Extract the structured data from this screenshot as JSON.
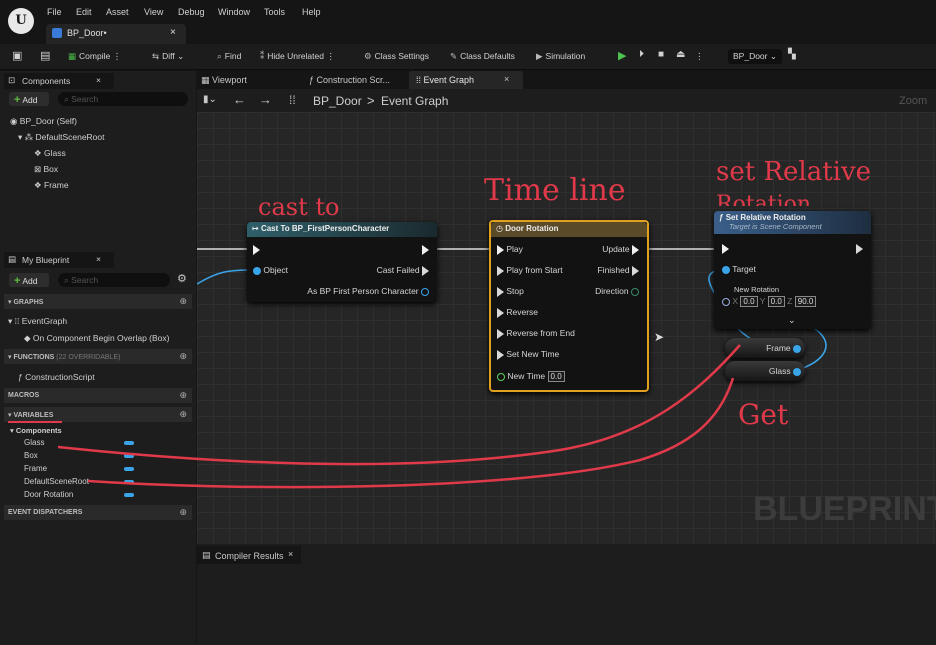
{
  "menu": [
    "File",
    "Edit",
    "Asset",
    "View",
    "Debug",
    "Window",
    "Tools",
    "Help"
  ],
  "doc_tab": {
    "label": "BP_Door•",
    "close": "×"
  },
  "toolbar": {
    "compile": "Compile",
    "diff": "Diff",
    "find": "Find",
    "hide_unrelated": "Hide Unrelated",
    "class_settings": "Class Settings",
    "class_defaults": "Class Defaults",
    "simulation": "Simulation",
    "debug_object": "BP_Door"
  },
  "components_panel": {
    "title": "Components",
    "add": "Add",
    "search_placeholder": "Search",
    "items": [
      "BP_Door (Self)",
      "DefaultSceneRoot",
      "Glass",
      "Box",
      "Frame"
    ]
  },
  "my_blueprint": {
    "title": "My Blueprint",
    "add": "Add",
    "search_placeholder": "Search",
    "graphs_label": "GRAPHS",
    "event_graph": "EventGraph",
    "overlap_event": "On Component Begin Overlap (Box)",
    "functions_label": "FUNCTIONS",
    "functions_hint": "(22 OVERRIDABLE)",
    "construction_script": "ConstructionScript",
    "macros_label": "MACROS",
    "variables_label": "VARIABLES",
    "components_category": "Components",
    "variables": [
      "Glass",
      "Box",
      "Frame",
      "DefaultSceneRoot",
      "Door Rotation"
    ],
    "dispatchers_label": "EVENT DISPATCHERS"
  },
  "editor_tabs": [
    "Viewport",
    "Construction Scr...",
    "Event Graph"
  ],
  "breadcrumb": {
    "blueprint": "BP_Door",
    "separator": ">",
    "graph": "Event Graph",
    "zoom": "Zoom"
  },
  "cast_node": {
    "title": "Cast To BP_FirstPersonCharacter",
    "object": "Object",
    "cast_failed": "Cast Failed",
    "as_output": "As BP First Person Character"
  },
  "timeline_node": {
    "title": "Door Rotation",
    "inputs": [
      "Play",
      "Play from Start",
      "Stop",
      "Reverse",
      "Reverse from End",
      "Set New Time"
    ],
    "new_time_label": "New Time",
    "new_time_value": "0.0",
    "outputs": [
      "Update",
      "Finished",
      "Direction"
    ]
  },
  "set_rotation_node": {
    "title": "Set Relative Rotation",
    "subtitle": "Target is Scene Component",
    "target": "Target",
    "new_rotation": "New Rotation",
    "x_label": "X",
    "x": "0.0",
    "y_label": "Y",
    "y": "0.0",
    "z_label": "Z",
    "z": "90.0"
  },
  "get_nodes": {
    "frame": "Frame",
    "glass": "Glass"
  },
  "annotations": {
    "cast": "cast to",
    "timeline": "Time line",
    "set_rel": "set Relative",
    "rotation": "Rotation",
    "get": "Get"
  },
  "watermark": "BLUEPRINT",
  "bottom_panel": {
    "title": "Compiler Results"
  },
  "colors": {
    "accent_green": "#5fbf40",
    "pin_blue": "#3aa4e8",
    "timeline_border": "#e0a020",
    "annotation_red": "#e03a4a",
    "cast_header": "#2f5f6a",
    "set_header": "#3a5f8a"
  }
}
